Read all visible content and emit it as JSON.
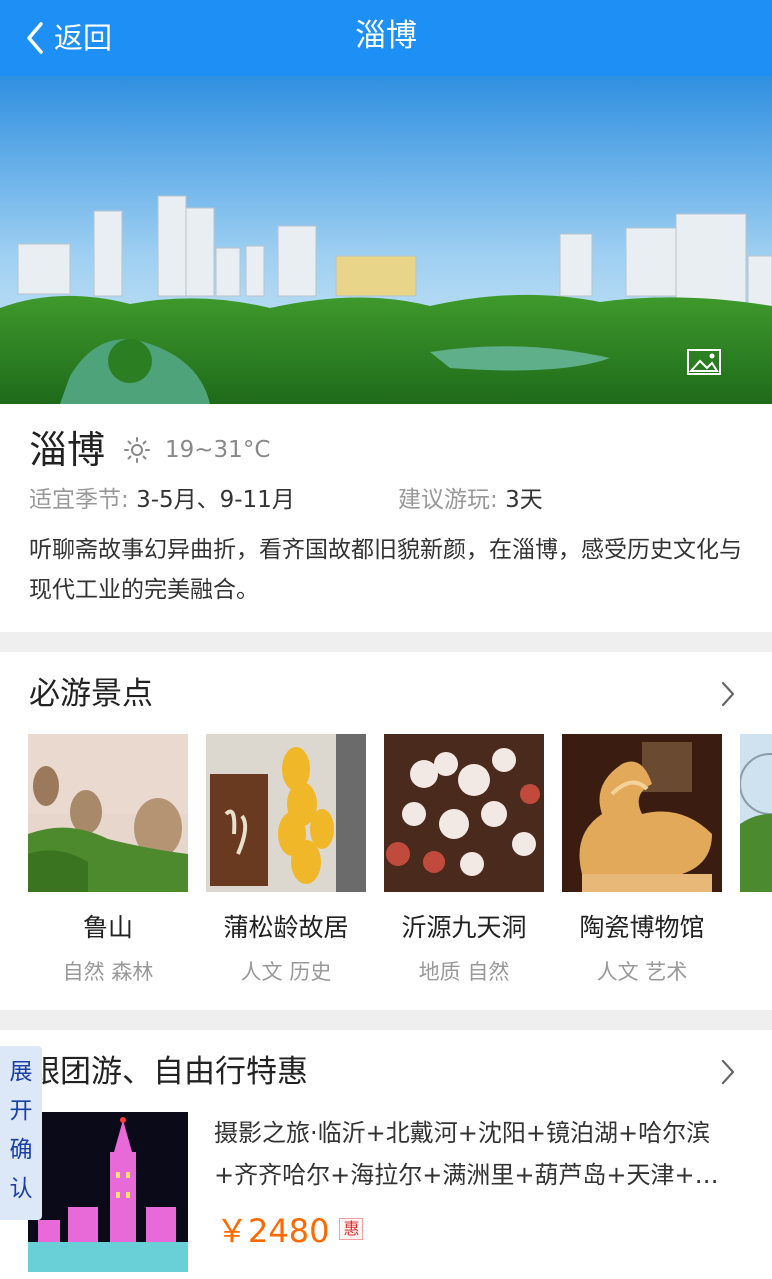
{
  "header": {
    "back_label": "返回",
    "title": "淄博",
    "bg_color": "#1e90f5"
  },
  "hero": {
    "gallery_icon": "image-gallery-icon"
  },
  "info": {
    "city": "淄博",
    "weather_icon": "sun-icon",
    "temperature": "19~31°C",
    "season_label": "适宜季节: ",
    "season_value": "3-5月、9-11月",
    "days_label": "建议游玩: ",
    "days_value": "3天",
    "description": "听聊斋故事幻异曲折，看齐国故都旧貌新颜，在淄博，感受历史文化与现代工业的完美融合。"
  },
  "spots": {
    "title": "必游景点",
    "items": [
      {
        "name": "鲁山",
        "tags": "自然 森林"
      },
      {
        "name": "蒲松龄故居",
        "tags": "人文 历史"
      },
      {
        "name": "沂源九天洞",
        "tags": "地质 自然"
      },
      {
        "name": "陶瓷博物馆",
        "tags": "人文 艺术"
      },
      {
        "name": "",
        "tags": ""
      }
    ]
  },
  "deals": {
    "title": "跟团游、自由行特惠",
    "items": [
      {
        "title": "摄影之旅·临沂+北戴河+沈阳+镜泊湖+哈尔滨+齐齐哈尔+海拉尔+满洲里+葫芦岛+天津+…",
        "price": "￥2480",
        "badge": "惠"
      }
    ],
    "price_color": "#ff6a00"
  },
  "float_tab": {
    "chars": [
      "展",
      "开",
      "确",
      "认"
    ]
  }
}
